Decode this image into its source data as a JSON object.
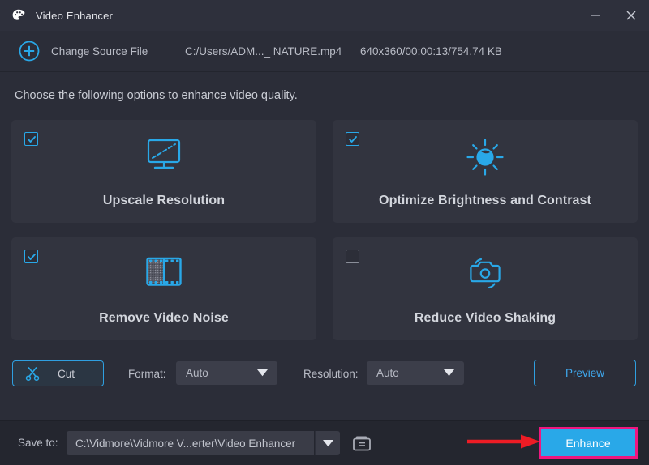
{
  "window": {
    "title": "Video Enhancer",
    "app_icon": "palette-icon",
    "minimize_label": "–",
    "close_label": "✕"
  },
  "source": {
    "plus_icon": "plus-circle-icon",
    "change_label": "Change Source File",
    "path": "C:/Users/ADM..._ NATURE.mp4",
    "meta": "640x360/00:00:13/754.74 KB"
  },
  "instruction": "Choose the following options to enhance video quality.",
  "options": [
    {
      "label": "Upscale Resolution",
      "checked": true,
      "icon": "monitor-upscale-icon"
    },
    {
      "label": "Optimize Brightness and Contrast",
      "checked": true,
      "icon": "brightness-sun-icon"
    },
    {
      "label": "Remove Video Noise",
      "checked": true,
      "icon": "film-strip-noise-icon"
    },
    {
      "label": "Reduce Video Shaking",
      "checked": false,
      "icon": "camera-stabilize-icon"
    }
  ],
  "controls": {
    "cut_label": "Cut",
    "cut_icon": "scissors-icon",
    "format_label": "Format:",
    "format_value": "Auto",
    "resolution_label": "Resolution:",
    "resolution_value": "Auto",
    "preview_label": "Preview"
  },
  "bottom": {
    "saveto_label": "Save to:",
    "saveto_path": "C:\\Vidmore\\Vidmore V...erter\\Video Enhancer",
    "folder_icon": "folder-open-icon",
    "enhance_label": "Enhance"
  },
  "annotation": {
    "arrow_icon": "red-arrow-right",
    "arrow_color": "#ee1c25",
    "highlight_color": "#f0177f"
  },
  "colors": {
    "accent": "#29a8e8",
    "window_bg": "#2b2d38",
    "card_bg": "#32343f",
    "titlebar_bg": "#2e303c",
    "bottombar_bg": "#24262f"
  }
}
